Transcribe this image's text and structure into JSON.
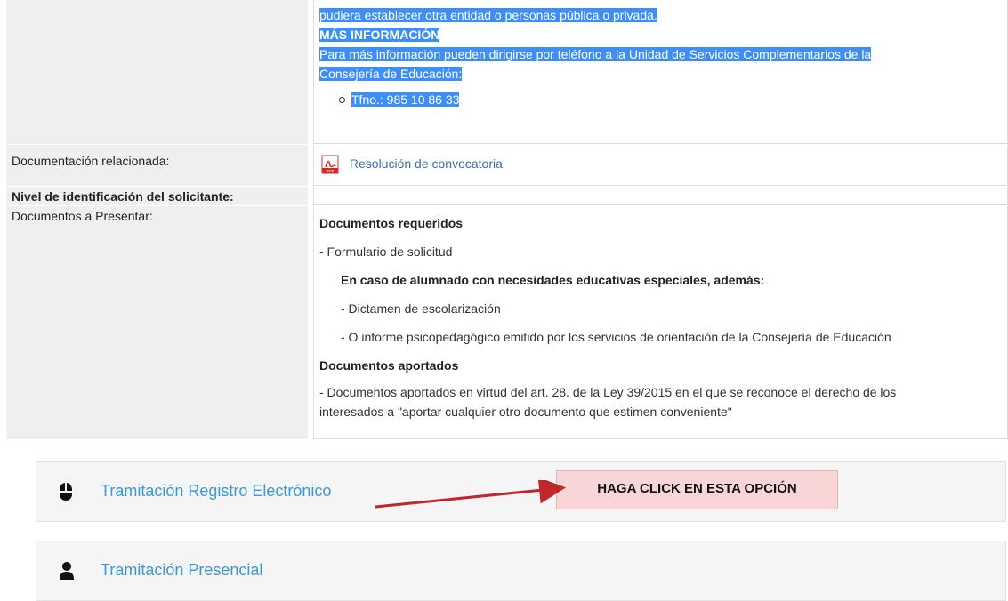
{
  "top_block": {
    "line1": "pudiera establecer otra entidad o personas pública o privada.",
    "heading": "MÁS INFORMACIÓN",
    "line2": "Para más información pueden dirigirse por teléfono a la Unidad de Servicios Complementarios de la",
    "line3": "Consejería de Educación:",
    "phone": "Tfno.: 985 10 86 33"
  },
  "rows": {
    "documentacion_label": "Documentación relacionada:",
    "documentacion_link": "Resolución de convocatoria",
    "nivel_label": "Nivel de identificación del solicitante:",
    "documentos_label": "Documentos a Presentar:"
  },
  "docs": {
    "req_heading": "Documentos requeridos",
    "req_item": "- Formulario de solicitud",
    "special_heading": "En caso de alumnado con necesidades educativas especiales, además:",
    "special_item1": "- Dictamen de escolarización",
    "special_item2": "- O informe psicopedagógico emitido por los servicios de orientación de la Consejería de Educación",
    "aport_heading": "Documentos aportados",
    "aport_text1": "- Documentos aportados en virtud del art. 28. de la Ley 39/2015 en el que se reconoce el derecho de los",
    "aport_text2": "interesados a \"aportar cualquier otro documento que estimen conveniente\""
  },
  "actions": {
    "electronic": "Tramitación Registro Electrónico",
    "presencial": "Tramitación Presencial"
  },
  "callout": "HAGA CLICK EN ESTA OPCIÓN",
  "colors": {
    "highlight": "#3d8ef7",
    "link": "#3a99d4",
    "callout_bg": "#f8d5d6",
    "arrow": "#c0272d"
  },
  "icons": {
    "pdf": "pdf-icon",
    "mouse": "mouse-icon",
    "person": "user-icon"
  }
}
